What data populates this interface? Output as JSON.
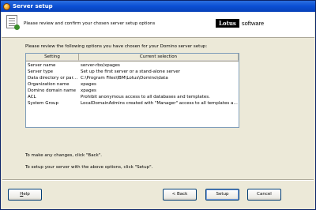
{
  "window": {
    "title": "Server setup"
  },
  "header": {
    "instruction": "Please review and confirm your chosen server setup options",
    "logo_mark": "Lotus",
    "logo_text": "software"
  },
  "intro": "Please review the following options you have chosen for your Domino server setup:",
  "grid": {
    "columns": [
      "Setting",
      "Current selection"
    ],
    "rows": [
      {
        "setting": "Server name",
        "selection": "server-rbo/xpages"
      },
      {
        "setting": "Server type",
        "selection": "Set up the first server or a stand-alone server"
      },
      {
        "setting": "Data directory or partition",
        "selection": "C:\\Program Files\\IBM\\Lotus\\Domino\\data"
      },
      {
        "setting": "Organization name",
        "selection": "xpages"
      },
      {
        "setting": "Domino domain name",
        "selection": "xpages"
      },
      {
        "setting": "ACL",
        "selection": "Prohibit  anonymous access to all databases and templates."
      },
      {
        "setting": "System Group",
        "selection": "LocalDomainAdmins created with \"Manager\" access to all templates and datab..."
      }
    ]
  },
  "notes": {
    "change": "To make any changes, click \"Back\".",
    "setup": "To setup your server with the above options, click \"Setup\"."
  },
  "buttons": {
    "help": "Help",
    "back": "< Back",
    "setup": "Setup",
    "cancel": "Cancel"
  }
}
